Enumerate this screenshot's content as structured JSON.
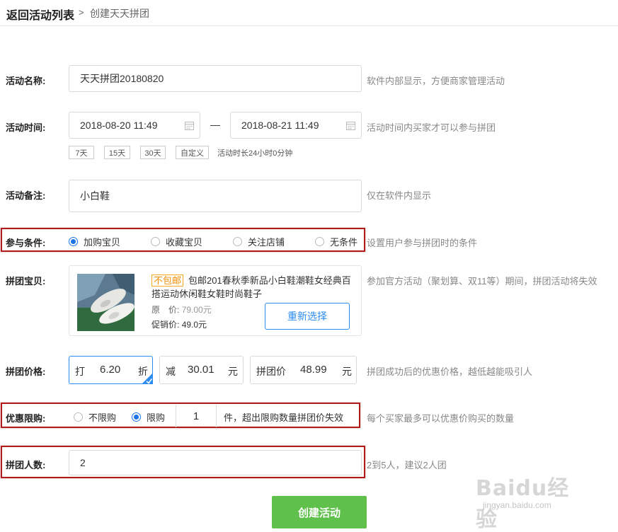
{
  "header": {
    "back_label": "返回活动列表",
    "separator": ">",
    "current": "创建天天拼团"
  },
  "fields": {
    "name": {
      "label": "活动名称:",
      "value": "天天拼团20180820",
      "hint": "软件内部显示，方便商家管理活动"
    },
    "time": {
      "label": "活动时间:",
      "start": "2018-08-20 11:49",
      "dash": "—",
      "end": "2018-08-21 11:49",
      "hint": "活动时间内买家才可以参与拼团",
      "presets": [
        "7天",
        "15天",
        "30天",
        "自定义"
      ],
      "duration_text": "活动时长24小时0分钟"
    },
    "remark": {
      "label": "活动备注:",
      "value": "小白鞋",
      "hint": "仅在软件内显示"
    },
    "condition": {
      "label": "参与条件:",
      "options": [
        "加购宝贝",
        "收藏宝贝",
        "关注店铺",
        "无条件"
      ],
      "selected_index": 0,
      "hint": "设置用户参与拼团时的条件"
    },
    "product": {
      "label": "拼团宝贝:",
      "tag": "不包邮",
      "title": "包邮201春秋季新品小白鞋潮鞋女经典百搭运动休闲鞋女鞋时尚鞋子",
      "original_label": "原　价:",
      "original_price": "79.00元",
      "promo_label": "促销价:",
      "promo_price": "49.0元",
      "reselect_label": "重新选择",
      "hint": "参加官方活动（聚划算、双11等）期间，拼团活动将失效"
    },
    "price": {
      "label": "拼团价格:",
      "discount_prefix": "打",
      "discount_value": "6.20",
      "discount_suffix": "折",
      "minus_prefix": "减",
      "minus_value": "30.01",
      "minus_suffix": "元",
      "group_prefix": "拼团价",
      "group_value": "48.99",
      "group_suffix": "元",
      "hint": "拼团成功后的优惠价格，越低越能吸引人"
    },
    "limit": {
      "label": "优惠限购:",
      "options": [
        "不限购",
        "限购"
      ],
      "selected_index": 1,
      "quantity": "1",
      "suffix": "件，超出限购数量拼团价失效",
      "hint": "每个买家最多可以优惠价购买的数量"
    },
    "group_size": {
      "label": "拼团人数:",
      "value": "2",
      "hint": "2到5人，建议2人团"
    }
  },
  "submit_label": "创建活动",
  "watermark": {
    "logo": "Baidu经验",
    "sub": "jingyan.baidu.com"
  },
  "colors": {
    "accent": "#2d8cf0",
    "submit": "#5fc14b",
    "highlight": "#b01c1c",
    "tag": "#f08c00"
  }
}
